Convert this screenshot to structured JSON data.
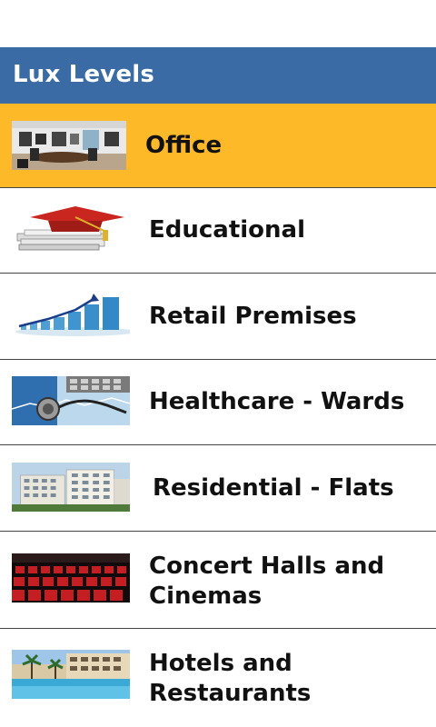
{
  "header": {
    "title": "Lux Levels"
  },
  "items": [
    {
      "label": "Office",
      "icon": "office-room-icon"
    },
    {
      "label": "Educational",
      "icon": "graduation-cap-books-icon"
    },
    {
      "label": "Retail Premises",
      "icon": "growth-bar-chart-icon"
    },
    {
      "label": "Healthcare - Wards",
      "icon": "stethoscope-icon"
    },
    {
      "label": "Residential - Flats",
      "icon": "apartment-building-icon"
    },
    {
      "label": "Concert Halls and Cinemas",
      "icon": "cinema-seats-icon"
    },
    {
      "label": "Hotels and Restaurants",
      "icon": "hotel-pool-icon"
    }
  ],
  "colors": {
    "header": "#3a6ba5",
    "selected": "#fdb927",
    "divider": "#444444"
  }
}
